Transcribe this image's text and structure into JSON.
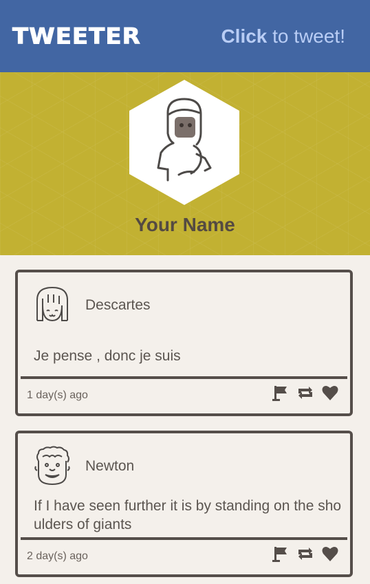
{
  "header": {
    "logo": "TWEETER",
    "cta_bold": "Click",
    "cta_rest": " to tweet!"
  },
  "profile": {
    "name": "Your Name",
    "banner_color": "#c2b132",
    "header_color": "#4266a3"
  },
  "tweets": [
    {
      "author": "Descartes",
      "text": "Je pense , donc je suis",
      "time": "1 day(s) ago",
      "avatar_icon": "girl-face-icon"
    },
    {
      "author": "Newton",
      "text": "If I have seen further it is by standing on the shoulders of giants",
      "time": "2 day(s) ago",
      "avatar_icon": "curly-hair-face-icon"
    }
  ],
  "action_icons": [
    "flag-icon",
    "retweet-icon",
    "heart-icon"
  ]
}
